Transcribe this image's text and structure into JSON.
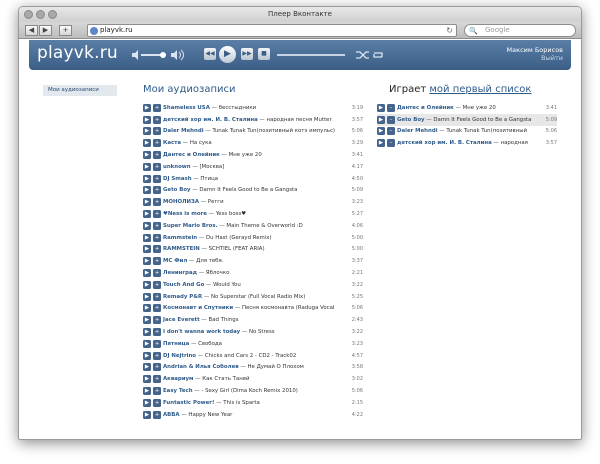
{
  "window": {
    "title": "Плеер Вконтакте"
  },
  "browser": {
    "url": "playvk.ru",
    "search_placeholder": "Google",
    "back": "◀",
    "forward": "▶",
    "add": "+",
    "reload": "↻"
  },
  "header": {
    "logo": "playvk.ru",
    "user": "Максим Борисов",
    "logout": "Выйти"
  },
  "sidebar": {
    "items": [
      {
        "label": "Мои аудиозаписи"
      }
    ]
  },
  "main": {
    "title": "Мои аудиозаписи",
    "tracks": [
      {
        "artist": "Shameless USA",
        "title": "бесстыдники",
        "duration": "3:19"
      },
      {
        "artist": "детский хор им. И. В. Сталина",
        "title": "народная песня Mutter",
        "duration": "3:57"
      },
      {
        "artist": "Daler Mehndi",
        "title": "Tunak Tunak Tun(позитивный котэ импульс)",
        "duration": "5:06"
      },
      {
        "artist": "Каста",
        "title": "На сука",
        "duration": "3:29"
      },
      {
        "artist": "Дантес и Олейник",
        "title": "Мне уже 20",
        "duration": "3:41"
      },
      {
        "artist": "unknown",
        "title": "[Москва]",
        "duration": "4:17"
      },
      {
        "artist": "DJ Smash",
        "title": "Птица",
        "duration": "4:50"
      },
      {
        "artist": "Geto Boy",
        "title": "Damn It Feels Good to Be a Gangsta",
        "duration": "5:09"
      },
      {
        "artist": "МОНОЛИЗА",
        "title": "Регги",
        "duration": "3:23"
      },
      {
        "artist": "♥Ness is more",
        "title": "Yess boss♥",
        "duration": "5:27"
      },
      {
        "artist": "Super Mario Bros.",
        "title": "Main Theme & Overworld :D",
        "duration": "4:06"
      },
      {
        "artist": "Rammstein",
        "title": "Du Hast (Gerayd Remix)",
        "duration": "5:00"
      },
      {
        "artist": "RAMMSTEIN",
        "title": "SCHTIEL (FEAT ARIA)",
        "duration": "5:00"
      },
      {
        "artist": "МС Фил",
        "title": "Для тебя.",
        "duration": "3:37"
      },
      {
        "artist": "Ленинград",
        "title": "Яблочко",
        "duration": "2:21"
      },
      {
        "artist": "Touch And Go",
        "title": "Would You",
        "duration": "3:22"
      },
      {
        "artist": "Remady P&R",
        "title": "No Superstar (Full Vocal Radio Mix)",
        "duration": "5:25"
      },
      {
        "artist": "Космонавт и Спутники",
        "title": "Песня космонавта (Raduga Vocal",
        "duration": "5:06"
      },
      {
        "artist": "Jace Everett",
        "title": "Bad Things",
        "duration": "2:43"
      },
      {
        "artist": "I don't wanna work today",
        "title": "No Stress",
        "duration": "3:22"
      },
      {
        "artist": "Пятница",
        "title": "Свобода",
        "duration": "3:23"
      },
      {
        "artist": "DJ Nejtrino",
        "title": "Chicks and Cars 2 - CD2 - Track02",
        "duration": "4:57"
      },
      {
        "artist": "Andrian & Илья Соболев",
        "title": "Не Думай О Плохом",
        "duration": "3:58"
      },
      {
        "artist": "Аквариум",
        "title": "Как Стать Таней",
        "duration": "3:02"
      },
      {
        "artist": "Easy Tech",
        "title": "- Sexy Girl (Dima Koch Remix 2010)",
        "duration": "5:06"
      },
      {
        "artist": "Funtastic Power!",
        "title": "This is Sparta",
        "duration": "2:15"
      },
      {
        "artist": "ABBA",
        "title": "Happy New Year",
        "duration": "4:22"
      }
    ]
  },
  "playlist": {
    "label": "Играет",
    "link": "мой первый список",
    "tracks": [
      {
        "artist": "Дантес и Олейник",
        "title": "Мне уже 20",
        "duration": "3:41"
      },
      {
        "artist": "Geto Boy",
        "title": "Damn It Feels Good to Be a Gangsta",
        "duration": "5:09"
      },
      {
        "artist": "Daler Mehndi",
        "title": "Tunak Tunak Tun(позитивный",
        "duration": "5:06"
      },
      {
        "artist": "детский хор им. И. В. Сталина",
        "title": "народная",
        "duration": "3:57"
      }
    ]
  },
  "icons": {
    "play": "play-icon",
    "add": "add-icon",
    "remove": "remove-icon",
    "shuffle": "shuffle-icon",
    "repeat": "repeat-icon"
  },
  "colors": {
    "header": "#3c5e86",
    "link": "#2f5b8a",
    "button": "#44648c"
  }
}
